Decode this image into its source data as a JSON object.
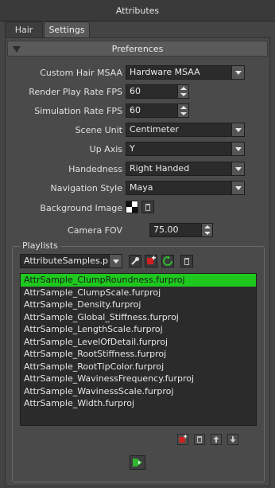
{
  "window": {
    "title": "Attributes"
  },
  "tabs": [
    {
      "label": "Hair"
    },
    {
      "label": "Settings"
    }
  ],
  "preferences": {
    "header": "Preferences",
    "fields": {
      "msaa": {
        "label": "Custom Hair MSAA",
        "value": "Hardware MSAA"
      },
      "render_fps": {
        "label": "Render Play Rate FPS",
        "value": "60"
      },
      "sim_fps": {
        "label": "Simulation Rate FPS",
        "value": "60"
      },
      "scene_unit": {
        "label": "Scene Unit",
        "value": "Centimeter"
      },
      "up_axis": {
        "label": "Up Axis",
        "value": "Y"
      },
      "handedness": {
        "label": "Handedness",
        "value": "Right Handed"
      },
      "nav_style": {
        "label": "Navigation Style",
        "value": "Maya"
      },
      "bg_image": {
        "label": "Background Image"
      },
      "camera_fov": {
        "label": "Camera FOV",
        "value": "75.00"
      }
    }
  },
  "playlists": {
    "title": "Playlists",
    "selected_file": "AttributeSamples.plist",
    "items": [
      "AttrSample_ClumpRoundness.furproj",
      "AttrSample_ClumpScale.furproj",
      "AttrSample_Density.furproj",
      "AttrSample_Global_Stiffness.furproj",
      "AttrSample_LengthScale.furproj",
      "AttrSample_LevelOfDetail.furproj",
      "AttrSample_RootStiffness.furproj",
      "AttrSample_RootTipColor.furproj",
      "AttrSample_WavinessFrequency.furproj",
      "AttrSample_WavinessScale.furproj",
      "AttrSample_Width.furproj"
    ],
    "selected_index": 0
  },
  "colors": {
    "selection": "#1ec81e",
    "accent_red": "#d02020",
    "accent_green": "#2fb82f"
  }
}
